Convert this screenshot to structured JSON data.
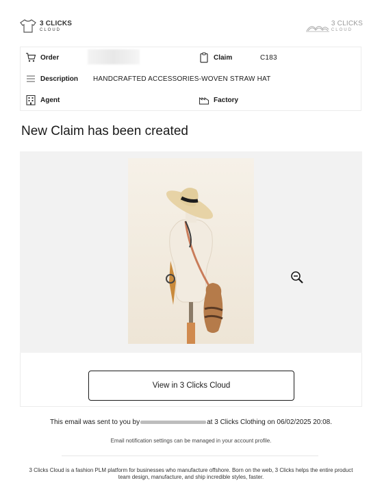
{
  "header": {
    "brand_left_line1": "3 CLICKS",
    "brand_left_line2": "CLOUD",
    "brand_right_line1": "3 CLICKS",
    "brand_right_line2": "CLOUD"
  },
  "info": {
    "order_label": "Order",
    "order_value": "",
    "claim_label": "Claim",
    "claim_value": "C183",
    "description_label": "Description",
    "description_value": "HANDCRAFTED ACCESSORIES-WOVEN STRAW HAT",
    "agent_label": "Agent",
    "agent_value": "",
    "factory_label": "Factory",
    "factory_value": ""
  },
  "main": {
    "title": "New Claim has been created",
    "view_button_label": "View in 3 Clicks Cloud"
  },
  "notice": {
    "sent_prefix": "This email was sent to you by",
    "sent_suffix": "at 3 Clicks Clothing on 06/02/2025 20:08.",
    "settings_text": "Email notification settings can be managed in your account profile."
  },
  "footer": {
    "text": "3 Clicks Cloud is a fashion PLM platform for businesses who manufacture offshore. Born on the web, 3 Clicks helps the entire product team design, manufacture, and ship incredible styles, faster."
  },
  "icons": {
    "order": "cart-icon",
    "claim": "clipboard-icon",
    "description": "lines-icon",
    "agent": "building-icon",
    "factory": "factory-icon",
    "zoom": "zoom-out-icon"
  }
}
